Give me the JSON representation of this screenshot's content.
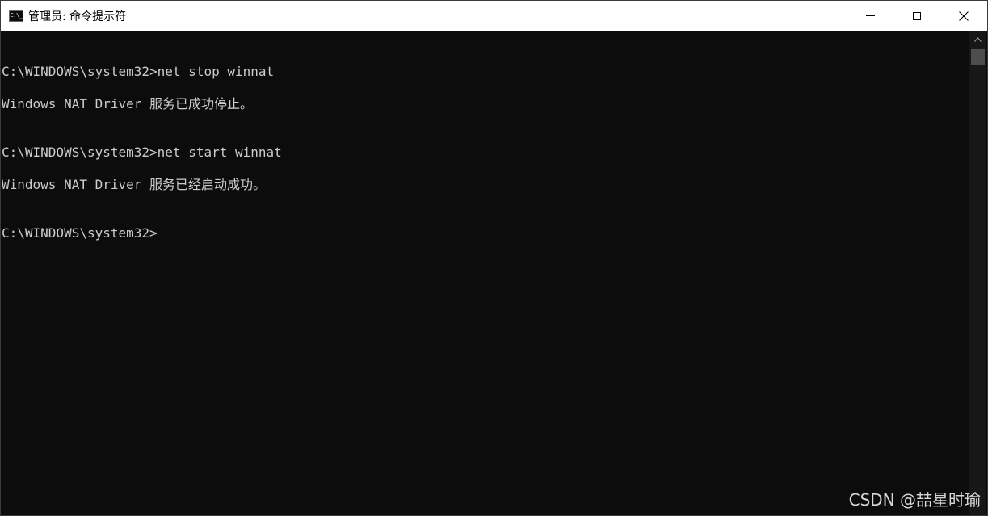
{
  "window": {
    "title": "管理员: 命令提示符",
    "icon_text": "C:\\_"
  },
  "console": {
    "lines": [
      "C:\\WINDOWS\\system32>net stop winnat",
      "Windows NAT Driver 服务已成功停止。",
      "C:\\WINDOWS\\system32>net start winnat",
      "Windows NAT Driver 服务已经启动成功。",
      "C:\\WINDOWS\\system32>"
    ]
  },
  "watermark": "CSDN @喆星时瑜",
  "colors": {
    "background": "#0c0c0c",
    "text": "#cccccc",
    "titlebar": "#ffffff"
  }
}
